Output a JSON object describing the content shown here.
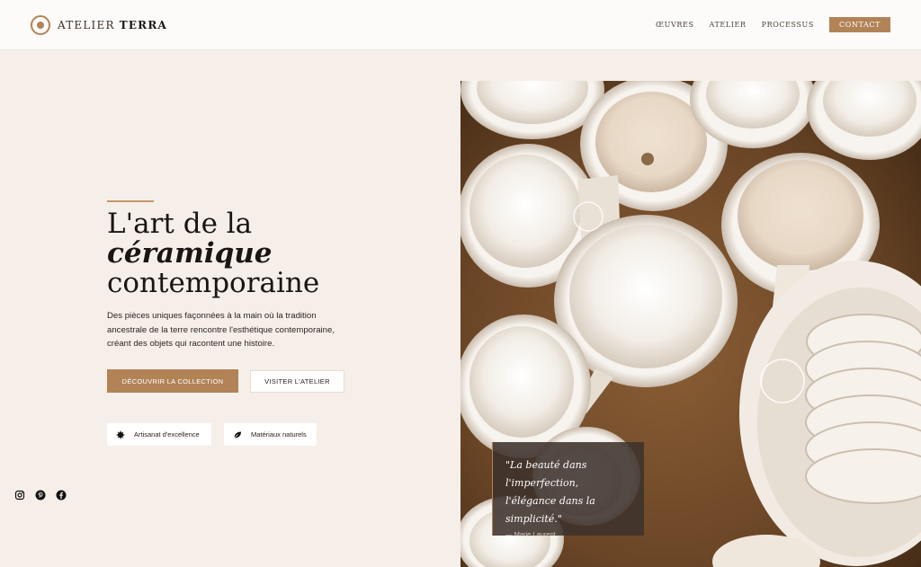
{
  "header": {
    "brand_light": "ATELIER ",
    "brand_bold": "TERRA",
    "nav": [
      {
        "label": "ŒUVRES"
      },
      {
        "label": "ATELIER"
      },
      {
        "label": "PROCESSUS"
      }
    ],
    "contact_label": "CONTACT"
  },
  "hero": {
    "title_line1": "L'art de la",
    "title_line2": "céramique",
    "title_line3": "contemporaine",
    "description": "Des pièces uniques façonnées à la main où la tradition ancestrale de la terre rencontre l'esthétique contemporaine, créant des objets qui racontent une histoire.",
    "primary_cta": "DÉCOUVRIR LA COLLECTION",
    "secondary_cta": "VISITER L'ATELIER",
    "badges": [
      {
        "label": "Artisanat d'excellence",
        "icon": "star-burst-icon"
      },
      {
        "label": "Matériaux naturels",
        "icon": "leaf-icon"
      }
    ]
  },
  "quote": {
    "text": "\"La beauté dans l'imperfection, l'élégance dans la simplicité.\"",
    "author": "— Marie Laurent"
  },
  "social": [
    "instagram-icon",
    "pinterest-icon",
    "facebook-icon"
  ],
  "colors": {
    "accent": "#b28357",
    "background": "#f6efe9",
    "text": "#1d1714"
  }
}
